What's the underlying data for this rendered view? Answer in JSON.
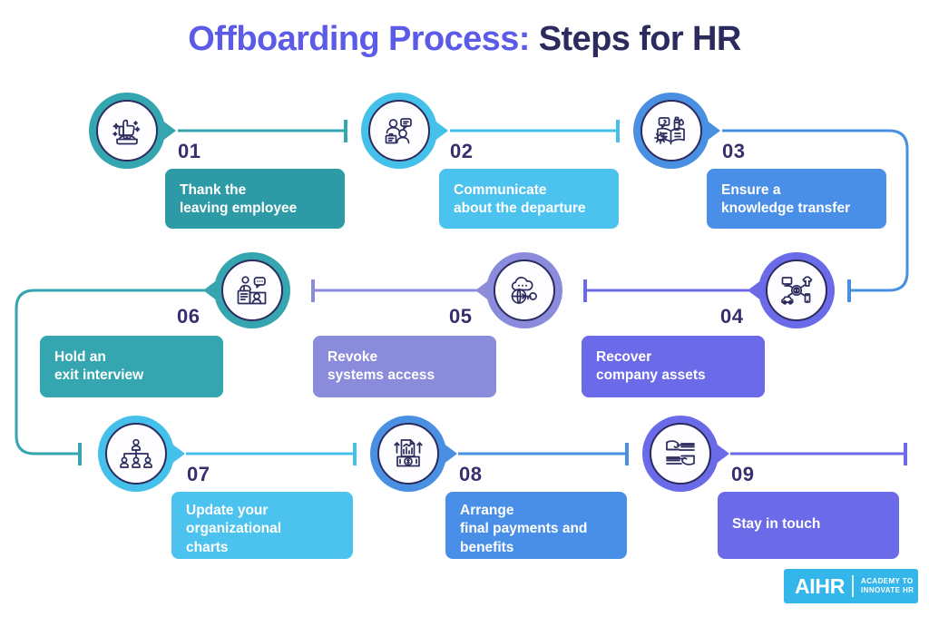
{
  "title": {
    "part1": "Offboarding Process:",
    "part2": " Steps for HR",
    "color_part1": "#5b5be8",
    "color_part2": "#2c2b5e"
  },
  "colors": {
    "teal": "#35a6b0",
    "teal_dark": "#2d9aa6",
    "sky": "#45c0ea",
    "sky_light": "#4cc3ef",
    "blue": "#4a90e2",
    "blue_mid": "#4a8fe7",
    "periwinkle": "#8b8bdc",
    "purple": "#6b6bea",
    "purple_deep": "#5f5fe8",
    "number": "#3a2d6d",
    "icon_stroke": "#2c2b5e",
    "background": "#ffffff"
  },
  "steps": [
    {
      "number": "01",
      "label": "Thank the\nleaving employee",
      "icon": "thumbs-up-cake-icon",
      "ring_color": "#35a6b0",
      "box_color": "#2d9aa6"
    },
    {
      "number": "02",
      "label": "Communicate\nabout the departure",
      "icon": "two-people-speech-bubble-icon",
      "ring_color": "#45c0ea",
      "box_color": "#4cc3ef"
    },
    {
      "number": "03",
      "label": "Ensure a\nknowledge transfer",
      "icon": "book-question-gear-icon",
      "ring_color": "#4a90e2",
      "box_color": "#4a8fe7"
    },
    {
      "number": "04",
      "label": "Recover\ncompany assets",
      "icon": "assets-monitor-coin-icon",
      "ring_color": "#6b6bea",
      "box_color": "#6b6bea"
    },
    {
      "number": "05",
      "label": "Revoke\nsystems access",
      "icon": "cloud-globe-key-icon",
      "ring_color": "#8b8bdc",
      "box_color": "#8b8bdc"
    },
    {
      "number": "06",
      "label": "Hold an\nexit interview",
      "icon": "exit-interview-icon",
      "ring_color": "#35a6b0",
      "box_color": "#35a6b0"
    },
    {
      "number": "07",
      "label": "Update your\norganizational\ncharts",
      "icon": "org-chart-icon",
      "ring_color": "#45c0ea",
      "box_color": "#4cc3ef"
    },
    {
      "number": "08",
      "label": "Arrange\nfinal payments and\nbenefits",
      "icon": "money-chart-icon",
      "ring_color": "#4a90e2",
      "box_color": "#4a8fe7"
    },
    {
      "number": "09",
      "label": "Stay in touch",
      "icon": "handshake-icon",
      "ring_color": "#6b6bea",
      "box_color": "#6b6bea"
    }
  ],
  "logo": {
    "main": "AIHR",
    "line1": "ACADEMY TO",
    "line2": "INNOVATE HR",
    "background": "#35b6ea"
  }
}
